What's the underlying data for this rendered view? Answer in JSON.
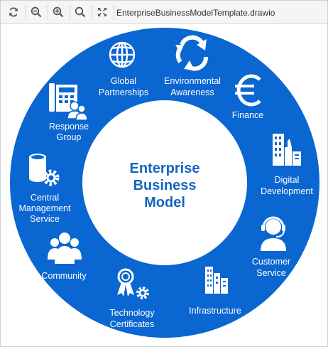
{
  "toolbar": {
    "buttons": [
      {
        "name": "refresh-button",
        "icon": "refresh-icon"
      },
      {
        "name": "zoom-out-button",
        "icon": "zoom-out-icon"
      },
      {
        "name": "zoom-in-button",
        "icon": "zoom-in-icon"
      },
      {
        "name": "zoom-fit-button",
        "icon": "zoom-fit-icon"
      },
      {
        "name": "fullscreen-button",
        "icon": "fullscreen-icon"
      }
    ],
    "file_title": "EnterpriseBusinessModelTemplate.drawio"
  },
  "diagram": {
    "colors": {
      "ring": "#0a66d1",
      "center": "#ffffff",
      "center_text": "#1565c0"
    },
    "center": {
      "line1": "Enterprise",
      "line2": "Business",
      "line3": "Model"
    },
    "segments": {
      "global_partnerships": {
        "line1": "Global",
        "line2": "Partnerships",
        "icon": "globe-icon"
      },
      "environmental_awareness": {
        "line1": "Environmental",
        "line2": "Awareness",
        "icon": "recycle-icon"
      },
      "finance": {
        "line1": "Finance",
        "icon": "euro-icon"
      },
      "digital_development": {
        "line1": "Digital",
        "line2": "Development",
        "icon": "city-buildings-icon"
      },
      "customer_service": {
        "line1": "Customer",
        "line2": "Service",
        "icon": "headset-agent-icon"
      },
      "infrastructure": {
        "line1": "Infrastructure",
        "icon": "buildings-icon"
      },
      "technology_certificates": {
        "line1": "Technology",
        "line2": "Certificates",
        "icon": "certificate-gear-icon"
      },
      "community": {
        "line1": "Community",
        "icon": "group-people-icon"
      },
      "central_management_service": {
        "line1": "Central",
        "line2": "Management",
        "line3": "Service",
        "icon": "database-gear-icon"
      },
      "response_group": {
        "line1": "Response",
        "line2": "Group",
        "icon": "phone-people-icon"
      }
    }
  }
}
